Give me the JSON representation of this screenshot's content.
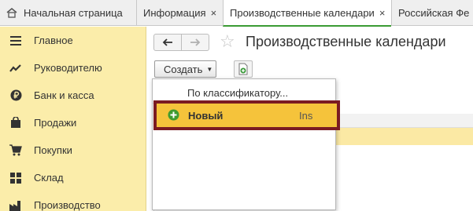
{
  "tabs": {
    "home": "Начальная страница",
    "items": [
      {
        "label": "Информация",
        "close": "×"
      },
      {
        "label": "Производственные календари",
        "close": "×"
      },
      {
        "label": "Российская Фе"
      }
    ]
  },
  "sidebar": {
    "items": [
      {
        "label": "Главное",
        "icon": "menu-lines-icon"
      },
      {
        "label": "Руководителю",
        "icon": "trend-chart-icon"
      },
      {
        "label": "Банк и касса",
        "icon": "ruble-coin-icon"
      },
      {
        "label": "Продажи",
        "icon": "shopping-bag-icon"
      },
      {
        "label": "Покупки",
        "icon": "shopping-cart-icon"
      },
      {
        "label": "Склад",
        "icon": "warehouse-grid-icon"
      },
      {
        "label": "Производство",
        "icon": "factory-icon"
      }
    ]
  },
  "content": {
    "title": "Производственные календари",
    "create_label": "Создать"
  },
  "dropdown": {
    "classifier_label": "По классификатору...",
    "new_label": "Новый",
    "new_shortcut": "Ins"
  },
  "colors": {
    "sidebar_bg": "#fbedaa",
    "highlight": "#f5c33b",
    "outline": "#7a1b22",
    "active_tab_accent": "#3b9b33"
  }
}
